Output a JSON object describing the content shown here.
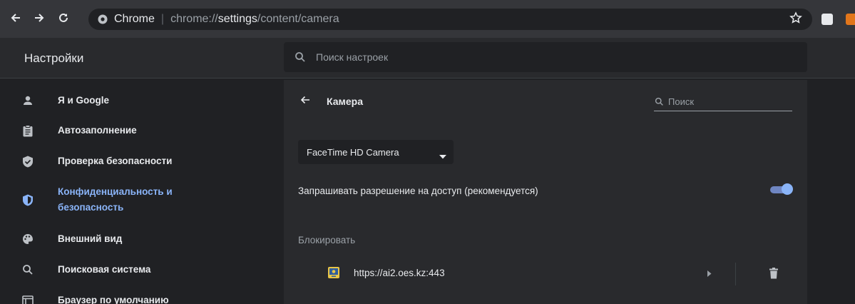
{
  "browser": {
    "chip_label": "Chrome",
    "url_prefix": "chrome://",
    "url_host": "settings",
    "url_path": "/content/camera"
  },
  "settings": {
    "title": "Настройки",
    "search_placeholder": "Поиск настроек"
  },
  "sidebar": {
    "items": [
      {
        "label": "Я и Google",
        "icon": "person-icon"
      },
      {
        "label": "Автозаполнение",
        "icon": "clipboard-icon"
      },
      {
        "label": "Проверка безопасности",
        "icon": "shield-check-icon"
      },
      {
        "label_line1": "Конфиденциальность и",
        "label_line2": "безопасность",
        "icon": "shield-icon",
        "active": true
      },
      {
        "label": "Внешний вид",
        "icon": "palette-icon"
      },
      {
        "label": "Поисковая система",
        "icon": "search-icon"
      },
      {
        "label": "Браузер по умолчанию",
        "icon": "browser-icon"
      }
    ]
  },
  "camera_page": {
    "title": "Камера",
    "search_placeholder": "Поиск",
    "device": "FaceTime HD Camera",
    "ask_label": "Запрашивать разрешение на доступ (рекомендуется)",
    "ask_enabled": true,
    "block_heading": "Блокировать",
    "blocked_sites": [
      {
        "url": "https://ai2.oes.kz:443"
      }
    ]
  },
  "colors": {
    "accent": "#8ab4f8",
    "background": "#202124",
    "card": "#292a2d"
  }
}
